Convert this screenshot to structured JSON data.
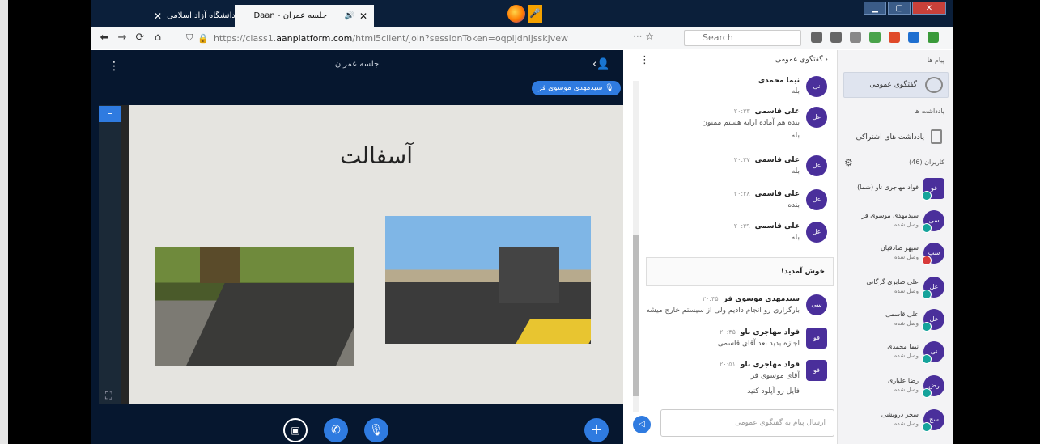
{
  "browser": {
    "tabs": [
      {
        "label": "دانشگاه آزاد اسلامی"
      },
      {
        "label": "جلسه عمران - Daan"
      }
    ],
    "url_prefix": "https://class1.",
    "url_domain": "aanplatform.com",
    "url_path": "/html5client/join?sessionToken=oqpljdnljsskjvew",
    "search_placeholder": "Search"
  },
  "presentation": {
    "meeting_title": "جلسه عمران",
    "speaker": "سیدمهدی موسوی فر",
    "slide_title": "آسفالت"
  },
  "chat": {
    "title": "گفتگوی عمومی",
    "messages": [
      {
        "avatar": "نی",
        "name": "نیما محمدی",
        "time": "",
        "lines": [
          "بله"
        ]
      },
      {
        "avatar": "عل",
        "name": "علی قاسمی",
        "time": "۲۰:۳۳",
        "lines": [
          "بنده هم آماده ارایه هستم ممنون",
          "بله"
        ]
      },
      {
        "avatar": "عل",
        "name": "علی قاسمی",
        "time": "۲۰:۳۷",
        "lines": [
          "بله"
        ]
      },
      {
        "avatar": "عل",
        "name": "علی قاسمی",
        "time": "۲۰:۳۸",
        "lines": [
          "بنده"
        ]
      },
      {
        "avatar": "عل",
        "name": "علی قاسمی",
        "time": "۲۰:۳۹",
        "lines": [
          "بله"
        ]
      }
    ],
    "welcome": "خوش آمدید!",
    "messages2": [
      {
        "avatar": "سی",
        "name": "سیدمهدی موسوی فر",
        "time": "۲۰:۴۵",
        "lines": [
          "بارگزاری رو انجام دادیم ولی از سیستم خارج میشه"
        ]
      },
      {
        "avatar": "فو",
        "name": "فواد مهاجری ناو",
        "time": "۲۰:۴۵",
        "lines": [
          "اجازه بدید بعد آقای قاسمی"
        ]
      },
      {
        "avatar": "فو",
        "name": "فواد مهاجری ناو",
        "time": "۲۰:۵۱",
        "lines": [
          "آقای موسوی فر",
          "فایل رو آپلود کنید"
        ]
      }
    ],
    "input_placeholder": "ارسال پیام به گفتگوی عمومی"
  },
  "panel": {
    "messages_header": "پیام ها",
    "public_chat": "گفتگوی عمومی",
    "notes_header": "یادداشت ها",
    "shared_notes": "یادداشت های اشتراکی",
    "users_header": "کاربران (46)",
    "users": [
      {
        "avatar": "فو",
        "name": "فواد مهاجری ناو (شما)",
        "status": ""
      },
      {
        "avatar": "سی",
        "name": "سیدمهدی موسوی فر",
        "status": "وصل شده"
      },
      {
        "avatar": "سپ",
        "name": "سپهر صادقیان",
        "status": "وصل شده"
      },
      {
        "avatar": "عل",
        "name": "علی صابری گرگانی",
        "status": "وصل شده"
      },
      {
        "avatar": "عل",
        "name": "علی قاسمی",
        "status": "وصل شده"
      },
      {
        "avatar": "نی",
        "name": "نیما محمدی",
        "status": "وصل شده"
      },
      {
        "avatar": "رض",
        "name": "رضا علیاری",
        "status": "وصل شده"
      },
      {
        "avatar": "سح",
        "name": "سحر درویشی",
        "status": "وصل شده"
      }
    ]
  }
}
